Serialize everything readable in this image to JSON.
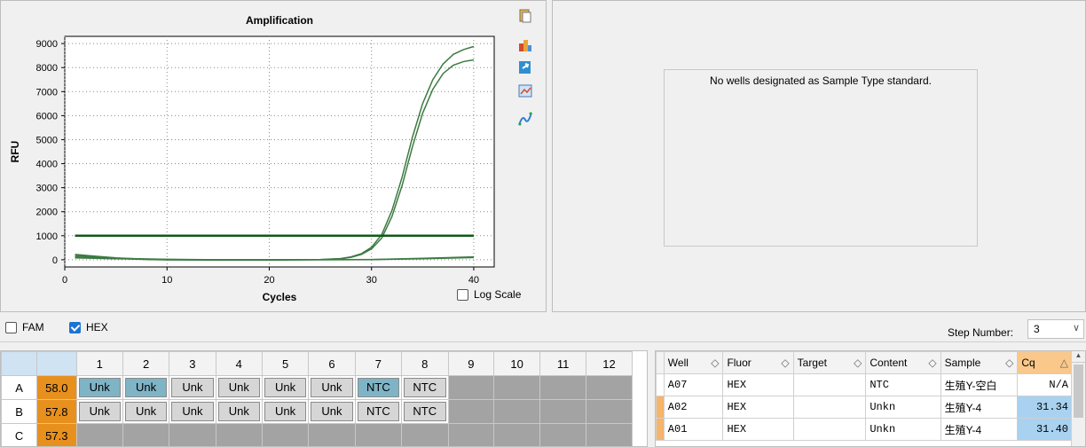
{
  "chart": {
    "title": "Amplification",
    "xlabel": "Cycles",
    "ylabel": "RFU",
    "log_scale_label": "Log Scale",
    "log_scale_checked": false
  },
  "chart_data": {
    "type": "line",
    "title": "Amplification",
    "xlabel": "Cycles",
    "ylabel": "RFU",
    "xlim": [
      0,
      42
    ],
    "ylim": [
      -300,
      9300
    ],
    "xticks": [
      0,
      10,
      20,
      30,
      40
    ],
    "yticks": [
      0,
      1000,
      2000,
      3000,
      4000,
      5000,
      6000,
      7000,
      8000,
      9000
    ],
    "grid": true,
    "threshold": 1000,
    "series": [
      {
        "x": [
          1,
          3,
          5,
          8,
          10,
          15,
          20,
          25,
          27,
          28,
          29,
          30,
          31,
          32,
          33,
          34,
          35,
          36,
          37,
          38,
          39,
          40
        ],
        "y": [
          220,
          150,
          80,
          20,
          0,
          -10,
          -10,
          10,
          50,
          120,
          250,
          520,
          1050,
          2050,
          3450,
          5100,
          6500,
          7500,
          8150,
          8550,
          8750,
          8880
        ]
      },
      {
        "x": [
          1,
          3,
          5,
          8,
          10,
          15,
          20,
          25,
          27,
          28,
          29,
          30,
          31,
          32,
          33,
          34,
          35,
          36,
          37,
          38,
          39,
          40
        ],
        "y": [
          180,
          120,
          60,
          10,
          -5,
          -10,
          -10,
          5,
          40,
          100,
          220,
          450,
          900,
          1800,
          3100,
          4700,
          6100,
          7100,
          7750,
          8100,
          8250,
          8320
        ]
      },
      {
        "x": [
          1,
          5,
          10,
          15,
          20,
          25,
          30,
          35,
          40
        ],
        "y": [
          120,
          60,
          20,
          0,
          0,
          0,
          10,
          60,
          120
        ]
      },
      {
        "x": [
          1,
          5,
          10,
          15,
          20,
          25,
          30,
          35,
          40
        ],
        "y": [
          80,
          40,
          10,
          -5,
          -5,
          0,
          5,
          40,
          90
        ]
      }
    ]
  },
  "standard_curve": {
    "message": "No wells designated as Sample Type standard."
  },
  "fluor_options": [
    {
      "label": "FAM",
      "checked": false
    },
    {
      "label": "HEX",
      "checked": true
    }
  ],
  "step": {
    "label": "Step Number:",
    "value": "3"
  },
  "plate": {
    "columns": [
      "1",
      "2",
      "3",
      "4",
      "5",
      "6",
      "7",
      "8",
      "9",
      "10",
      "11",
      "12"
    ],
    "rows": [
      {
        "label": "A",
        "value": "58.0",
        "wells": [
          "Unk",
          "Unk",
          "Unk",
          "Unk",
          "Unk",
          "Unk",
          "NTC",
          "NTC",
          "",
          "",
          "",
          ""
        ],
        "highlight": [
          true,
          true,
          false,
          false,
          false,
          false,
          true,
          false,
          false,
          false,
          false,
          false
        ]
      },
      {
        "label": "B",
        "value": "57.8",
        "wells": [
          "Unk",
          "Unk",
          "Unk",
          "Unk",
          "Unk",
          "Unk",
          "NTC",
          "NTC",
          "",
          "",
          "",
          ""
        ],
        "highlight": [
          false,
          false,
          false,
          false,
          false,
          false,
          false,
          false,
          false,
          false,
          false,
          false
        ]
      },
      {
        "label": "C",
        "value": "57.3",
        "wells": [
          "",
          "",
          "",
          "",
          "",
          "",
          "",
          "",
          "",
          "",
          "",
          ""
        ],
        "highlight": [
          false,
          false,
          false,
          false,
          false,
          false,
          false,
          false,
          false,
          false,
          false,
          false
        ]
      }
    ]
  },
  "well_table": {
    "columns": [
      "Well",
      "Fluor",
      "Target",
      "Content",
      "Sample",
      "Cq"
    ],
    "rows": [
      {
        "well": "A07",
        "fluor": "HEX",
        "target": "",
        "content": "NTC",
        "sample": "生殖Y-空白",
        "cq": "N/A"
      },
      {
        "well": "A02",
        "fluor": "HEX",
        "target": "",
        "content": "Unkn",
        "sample": "生殖Y-4",
        "cq": "31.34"
      },
      {
        "well": "A01",
        "fluor": "HEX",
        "target": "",
        "content": "Unkn",
        "sample": "生殖Y-4",
        "cq": "31.40"
      }
    ]
  },
  "colors": {
    "curve": "#3d7a42",
    "threshold": "#0f5a17",
    "row_value_bg": "#e8901d",
    "selected_well": "#7fb3c6"
  }
}
